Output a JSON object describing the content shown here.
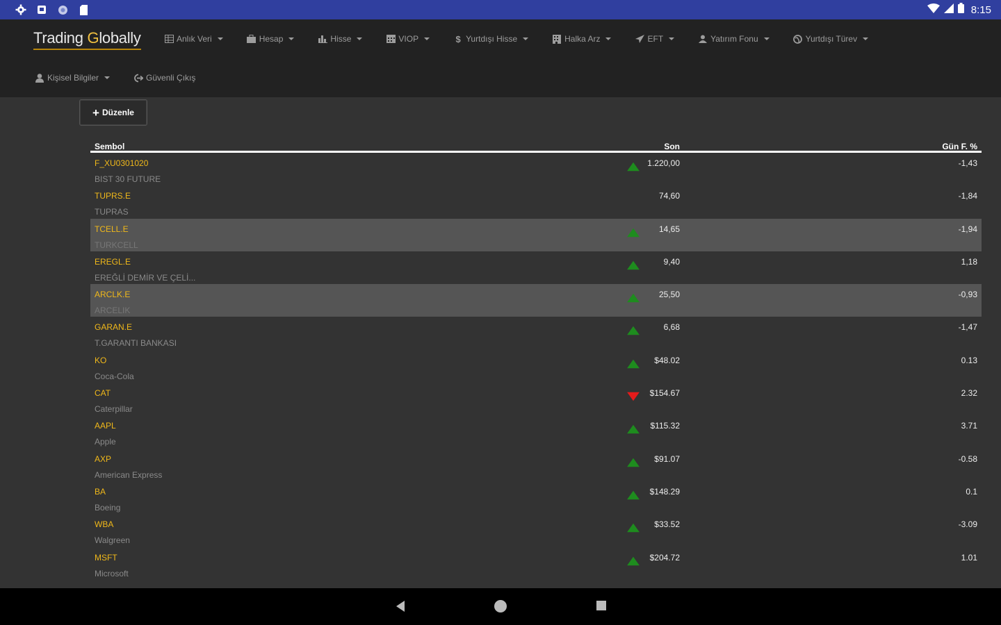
{
  "status_bar": {
    "time": "8:15",
    "left_icons": [
      "settings-icon",
      "square-app-icon",
      "circle-app-icon",
      "sd-card-icon"
    ],
    "right_icons": [
      "wifi-icon",
      "signal-icon",
      "battery-icon"
    ]
  },
  "brand": {
    "part1": "Trading ",
    "accent": "G",
    "part2": "lobally"
  },
  "nav_row1": [
    {
      "icon": "table-icon",
      "label": "Anlık Veri"
    },
    {
      "icon": "briefcase-icon",
      "label": "Hesap"
    },
    {
      "icon": "bar-chart-icon",
      "label": "Hisse"
    },
    {
      "icon": "calendar-icon",
      "label": "VIOP"
    },
    {
      "icon": "dollar-icon",
      "label": "Yurtdışı Hisse"
    },
    {
      "icon": "building-icon",
      "label": "Halka Arz"
    },
    {
      "icon": "send-icon",
      "label": "EFT"
    },
    {
      "icon": "person-icon",
      "label": "Yatırım Fonu"
    },
    {
      "icon": "globe-icon",
      "label": "Yurtdışı Türev"
    }
  ],
  "nav_row2": [
    {
      "icon": "user-icon",
      "label": "Kişisel Bilgiler",
      "caret": true
    },
    {
      "icon": "logout-icon",
      "label": "Güvenli Çıkış",
      "caret": false
    }
  ],
  "edit_button": {
    "label": "Düzenle"
  },
  "table": {
    "headers": {
      "symbol": "Sembol",
      "last": "Son",
      "change": "Gün F. %"
    },
    "rows": [
      {
        "symbol": "F_XU0301020",
        "name": "BIST 30 FUTURE",
        "last": "1.220,00",
        "change": "-1,43",
        "dir": "up",
        "highlight": false
      },
      {
        "symbol": "TUPRS.E",
        "name": "TUPRAS",
        "last": "74,60",
        "change": "-1,84",
        "dir": "none",
        "highlight": false
      },
      {
        "symbol": "TCELL.E",
        "name": "TURKCELL",
        "last": "14,65",
        "change": "-1,94",
        "dir": "up",
        "highlight": true
      },
      {
        "symbol": "EREGL.E",
        "name": "EREĞLİ DEMİR VE ÇELİ...",
        "last": "9,40",
        "change": "1,18",
        "dir": "up",
        "highlight": false
      },
      {
        "symbol": "ARCLK.E",
        "name": "ARCELIK",
        "last": "25,50",
        "change": "-0,93",
        "dir": "up",
        "highlight": true
      },
      {
        "symbol": "GARAN.E",
        "name": "T.GARANTI BANKASI",
        "last": "6,68",
        "change": "-1,47",
        "dir": "up",
        "highlight": false
      },
      {
        "symbol": "KO",
        "name": "Coca-Cola",
        "last": "$48.02",
        "change": "0.13",
        "dir": "up",
        "highlight": false
      },
      {
        "symbol": "CAT",
        "name": "Caterpillar",
        "last": "$154.67",
        "change": "2.32",
        "dir": "down",
        "highlight": false
      },
      {
        "symbol": "AAPL",
        "name": "Apple",
        "last": "$115.32",
        "change": "3.71",
        "dir": "up",
        "highlight": false
      },
      {
        "symbol": "AXP",
        "name": "American Express",
        "last": "$91.07",
        "change": "-0.58",
        "dir": "up",
        "highlight": false
      },
      {
        "symbol": "BA",
        "name": "Boeing",
        "last": "$148.29",
        "change": "0.1",
        "dir": "up",
        "highlight": false
      },
      {
        "symbol": "WBA",
        "name": "Walgreen",
        "last": "$33.52",
        "change": "-3.09",
        "dir": "up",
        "highlight": false
      },
      {
        "symbol": "MSFT",
        "name": "Microsoft",
        "last": "$204.72",
        "change": "1.01",
        "dir": "up",
        "highlight": false
      }
    ]
  },
  "colors": {
    "status_bar": "#303f9f",
    "navbar": "#222222",
    "page_bg": "#333333",
    "symbol": "#f0b81a",
    "up": "#1e8c1e",
    "down": "#e41b1b",
    "highlight_row": "#555555"
  },
  "bottom_nav": [
    "back-icon",
    "home-icon",
    "recents-icon"
  ]
}
